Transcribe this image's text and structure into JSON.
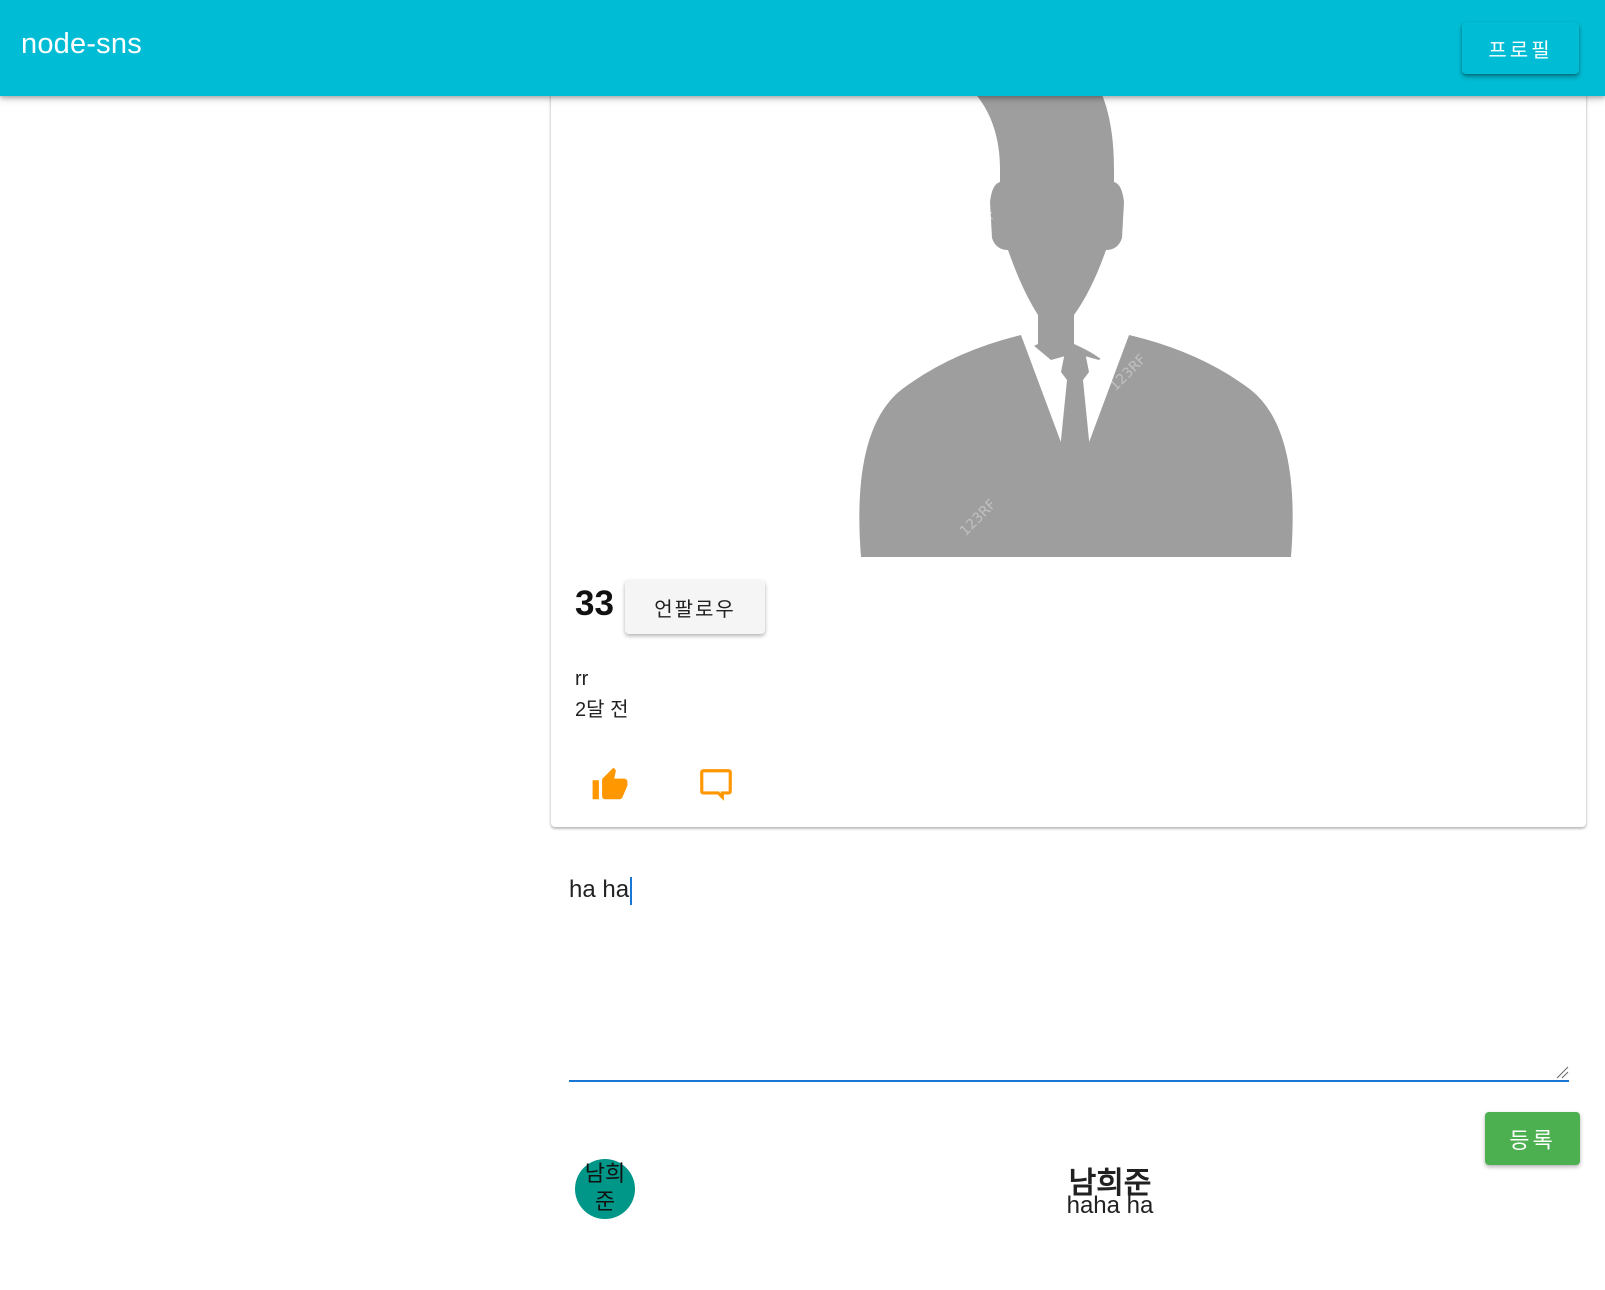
{
  "app_bar": {
    "brand": "node-sns",
    "profile_button": "프로필",
    "color": "#00bcd4"
  },
  "post": {
    "image": "person-silhouette",
    "like_count": "33",
    "unfollow_button": "언팔로우",
    "content": "rr",
    "time": "2달 전",
    "actions": {
      "like_icon": "thumbs-up-icon",
      "comment_icon": "comment-icon",
      "icon_color": "#ff9800"
    }
  },
  "comment_form": {
    "value": "ha ha",
    "submit_button": "등록",
    "submit_color": "#4caf50"
  },
  "comments": [
    {
      "avatar_text": "남희준",
      "author": "남희준",
      "text": "haha ha",
      "avatar_color": "#009688"
    }
  ]
}
